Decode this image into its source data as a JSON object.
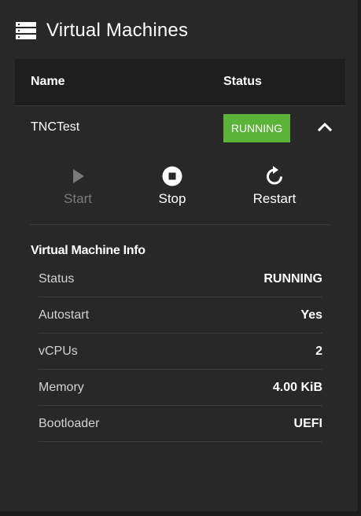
{
  "header": {
    "title": "Virtual Machines",
    "icon": "server-list-icon"
  },
  "table": {
    "columns": [
      "Name",
      "Status"
    ],
    "rows": [
      {
        "name": "TNCTest",
        "status": "RUNNING",
        "status_color": "#5cb33a",
        "expanded": true
      }
    ]
  },
  "actions": [
    {
      "label": "Start",
      "icon": "play-icon",
      "enabled": false
    },
    {
      "label": "Stop",
      "icon": "stop-circle-icon",
      "enabled": true
    },
    {
      "label": "Restart",
      "icon": "restart-icon",
      "enabled": true
    }
  ],
  "info": {
    "title": "Virtual Machine Info",
    "items": [
      {
        "key": "Status",
        "value": "RUNNING"
      },
      {
        "key": "Autostart",
        "value": "Yes"
      },
      {
        "key": "vCPUs",
        "value": "2"
      },
      {
        "key": "Memory",
        "value": "4.00 KiB"
      },
      {
        "key": "Bootloader",
        "value": "UEFI"
      }
    ]
  },
  "colors": {
    "background": "#282828",
    "header_row": "#1e1e1e",
    "accent_green": "#5cb33a",
    "disabled_text": "#7a7a7a"
  }
}
